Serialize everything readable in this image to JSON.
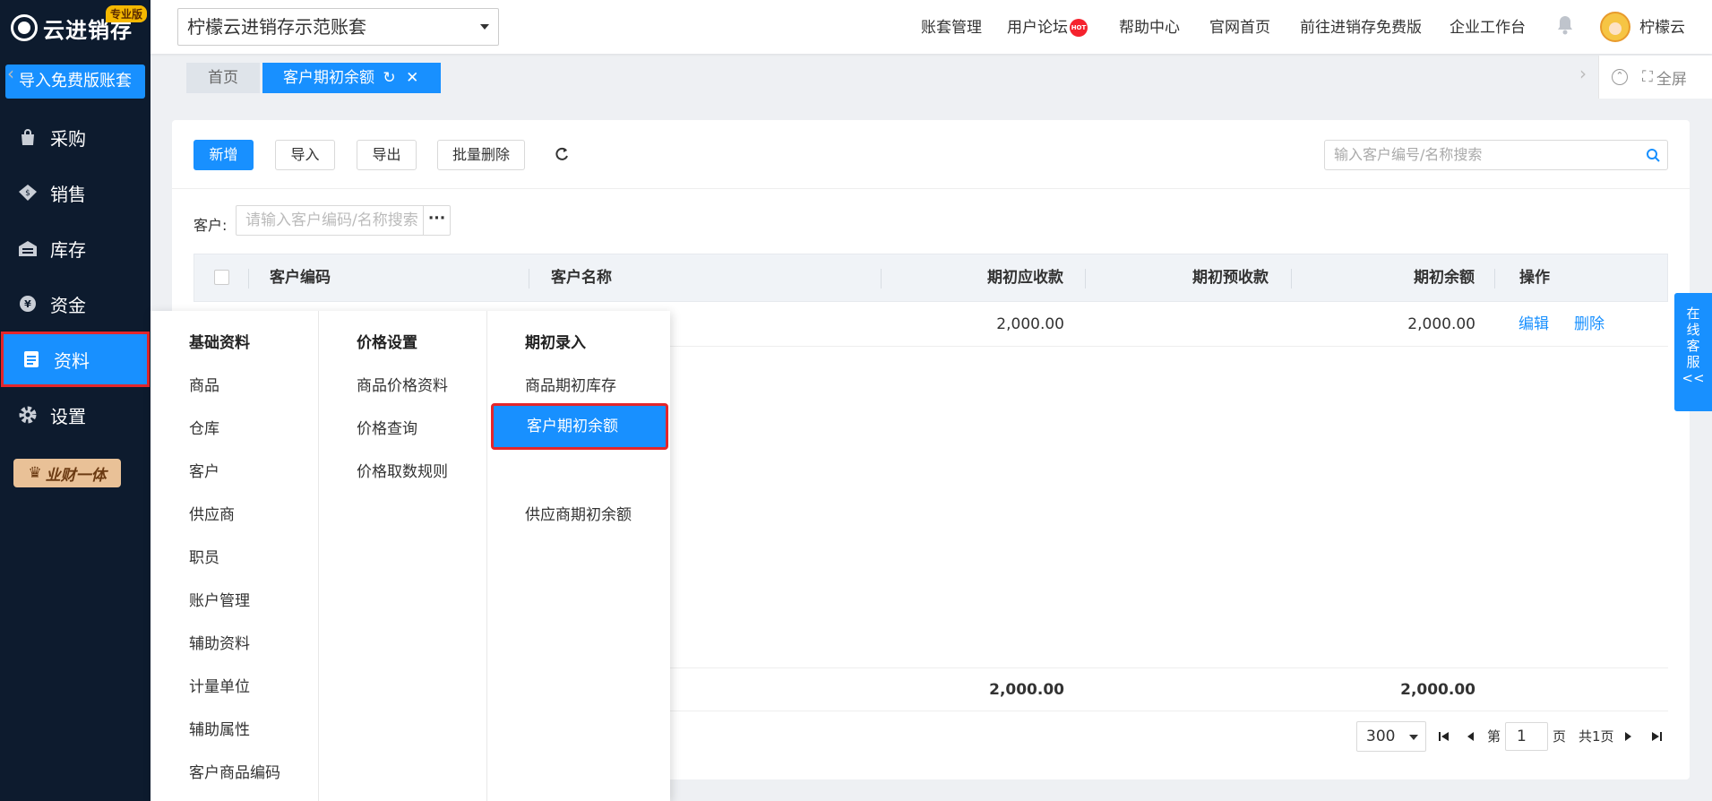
{
  "sidebar": {
    "logo": "云进销存",
    "badge": "专业版",
    "import_free": "导入免费版账套",
    "items": [
      {
        "label": "采购",
        "icon": "shopping-bag-icon"
      },
      {
        "label": "销售",
        "icon": "sales-tag-icon"
      },
      {
        "label": "库存",
        "icon": "warehouse-icon"
      },
      {
        "label": "资金",
        "icon": "yen-coin-icon"
      },
      {
        "label": "资料",
        "icon": "document-icon",
        "active": true
      },
      {
        "label": "设置",
        "icon": "gear-icon"
      }
    ],
    "promo": "业财一体"
  },
  "topbar": {
    "account": "柠檬云进销存示范账套",
    "links": [
      "账套管理",
      "用户论坛",
      "帮助中心",
      "官网首页",
      "前往进销存免费版",
      "企业工作台"
    ],
    "hot": "HOT",
    "username": "柠檬云"
  },
  "tabs": {
    "home": "首页",
    "current": "客户期初余额",
    "fullscreen": "全屏"
  },
  "toolbar": {
    "add": "新增",
    "import": "导入",
    "export": "导出",
    "batch_delete": "批量删除",
    "search_placeholder": "输入客户编号/名称搜索"
  },
  "filter": {
    "customer_label": "客户:",
    "customer_placeholder": "请输入客户编码/名称搜索",
    "more": "···"
  },
  "table": {
    "headers": [
      "客户编码",
      "客户名称",
      "期初应收款",
      "期初预收款",
      "期初余额",
      "操作"
    ],
    "rows": [
      {
        "code": "",
        "name": "",
        "receivable": "2,000.00",
        "prepaid": "",
        "balance": "2,000.00",
        "edit": "编辑",
        "delete": "删除"
      }
    ],
    "footer": {
      "receivable": "2,000.00",
      "balance": "2,000.00"
    }
  },
  "pagination": {
    "page_size": "300",
    "page_prefix": "第",
    "page": "1",
    "page_suffix": "页",
    "total": "共1页"
  },
  "menu": {
    "columns": [
      {
        "title": "基础资料",
        "items": [
          "商品",
          "仓库",
          "客户",
          "供应商",
          "职员",
          "账户管理",
          "辅助资料",
          "计量单位",
          "辅助属性",
          "客户商品编码"
        ]
      },
      {
        "title": "价格设置",
        "items": [
          "商品价格资料",
          "价格查询",
          "价格取数规则"
        ]
      },
      {
        "title": "期初录入",
        "items": [
          "商品期初库存",
          "客户期初余额",
          "供应商期初余额"
        ]
      }
    ]
  },
  "service": {
    "lines": [
      "在",
      "线",
      "客",
      "服",
      "<<"
    ]
  }
}
